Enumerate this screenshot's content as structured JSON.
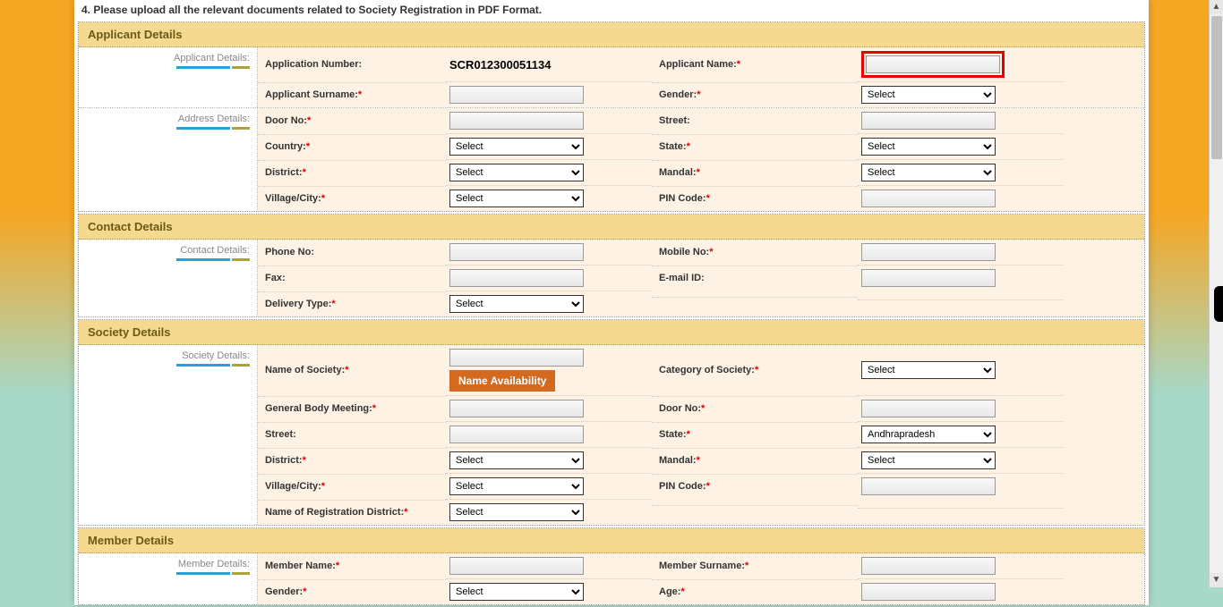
{
  "top_note": "4. Please upload all the relevant documents related to Society Registration in PDF Format.",
  "sections": {
    "applicant": {
      "title": "Applicant Details",
      "side1": "Applicant Details:",
      "side2": "Address Details:",
      "app_num_label": "Application Number:",
      "app_num_value": "SCR012300051134",
      "applicant_name": "Applicant Name:",
      "surname": "Applicant Surname:",
      "gender": "Gender:",
      "door": "Door No:",
      "street": "Street:",
      "country": "Country:",
      "state": "State:",
      "district": "District:",
      "mandal": "Mandal:",
      "village": "Village/City:",
      "pin": "PIN Code:"
    },
    "contact": {
      "title": "Contact Details",
      "side": "Contact Details:",
      "phone": "Phone No:",
      "mobile": "Mobile No:",
      "fax": "Fax:",
      "email": "E-mail ID:",
      "delivery": "Delivery Type:"
    },
    "society": {
      "title": "Society Details",
      "side": "Society Details:",
      "name": "Name of  Society:",
      "name_btn": "Name Availability",
      "category": "Category of Society:",
      "gbm": "General Body Meeting:",
      "door": "Door No:",
      "street": "Street:",
      "state": "State:",
      "state_value": "Andhrapradesh",
      "district": "District:",
      "mandal": "Mandal:",
      "village": "Village/City:",
      "pin": "PIN Code:",
      "reg_district": "Name of Registration District:"
    },
    "member": {
      "title": "Member Details",
      "side": "Member Details:",
      "name": "Member Name:",
      "surname": "Member Surname:",
      "gender": "Gender:",
      "age": "Age:"
    }
  },
  "select_placeholder": "Select"
}
